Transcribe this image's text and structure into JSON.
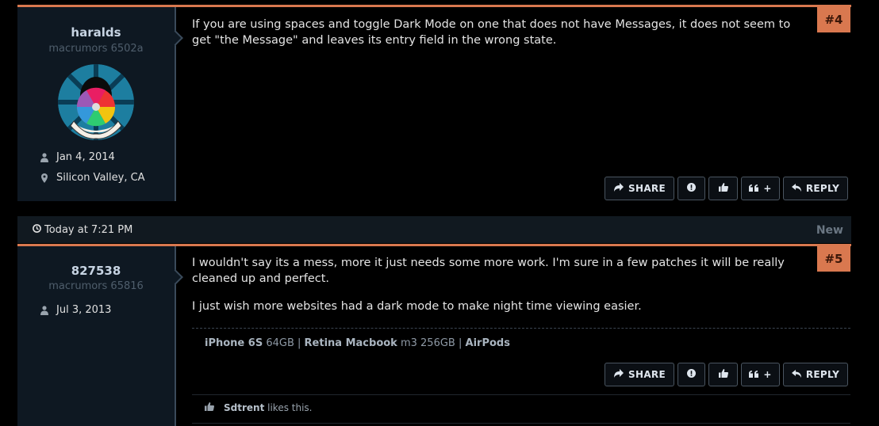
{
  "posts": [
    {
      "username": "haralds",
      "user_title": "macrumors 6502a",
      "joined": "Jan 4, 2014",
      "location": "Silicon Valley, CA",
      "number": "#4",
      "message": [
        "If you are using spaces and toggle Dark Mode on one that does not have Messages, it does not seem to get \"the Message\" and leaves its entry field in the wrong state."
      ]
    },
    {
      "username": "827538",
      "user_title": "macrumors 65816",
      "joined": "Jul 3, 2013",
      "number": "#5",
      "message": [
        "I wouldn't say its a mess, more it just needs some more work. I'm sure in a few patches it will be really cleaned up and perfect.",
        "I just wish more websites had a dark mode to make night time viewing easier."
      ],
      "signature": {
        "item1_bold": "iPhone 6S",
        "item1_rest": "64GB",
        "sep": "|",
        "item2_bold": "Retina Macbook",
        "item2_rest": "m3 256GB",
        "item3_bold": "AirPods"
      },
      "likes": {
        "user": "Sdtrent",
        "text": "likes this."
      }
    }
  ],
  "actions": {
    "share": "SHARE",
    "reply": "REPLY",
    "quote_plus": "+"
  },
  "separator": {
    "time": "Today at 7:21 PM",
    "new_label": "New"
  },
  "colors": {
    "accent": "#d9784f",
    "user_panel": "#0e1822"
  }
}
